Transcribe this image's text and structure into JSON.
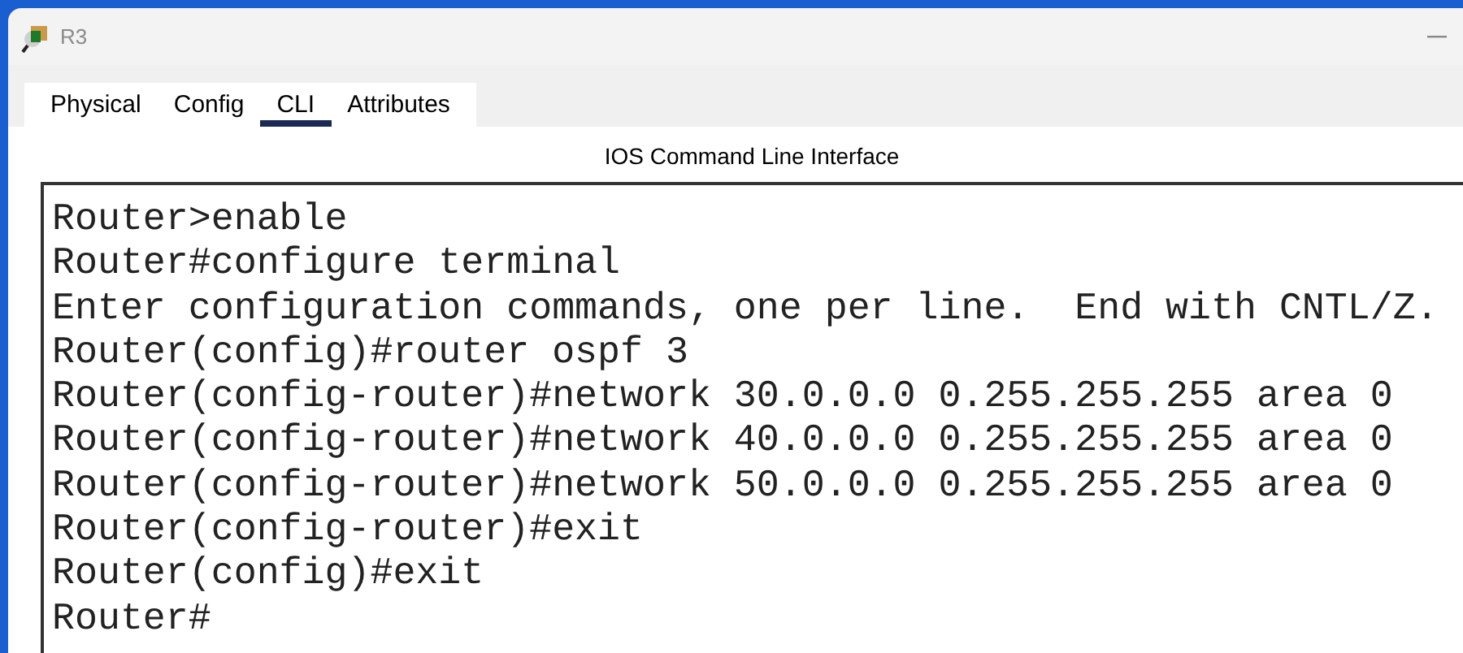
{
  "window": {
    "title": "R3"
  },
  "tabs": [
    {
      "label": "Physical",
      "selected": false
    },
    {
      "label": "Config",
      "selected": false
    },
    {
      "label": "CLI",
      "selected": true
    },
    {
      "label": "Attributes",
      "selected": false
    }
  ],
  "panel": {
    "title": "IOS Command Line Interface"
  },
  "terminal": {
    "lines": [
      "Router>enable",
      "Router#configure terminal",
      "Enter configuration commands, one per line.  End with CNTL/Z.",
      "Router(config)#router ospf 3",
      "Router(config-router)#network 30.0.0.0 0.255.255.255 area 0",
      "Router(config-router)#network 40.0.0.0 0.255.255.255 area 0",
      "Router(config-router)#network 50.0.0.0 0.255.255.255 area 0",
      "Router(config-router)#exit",
      "Router(config)#exit",
      "Router#"
    ]
  }
}
